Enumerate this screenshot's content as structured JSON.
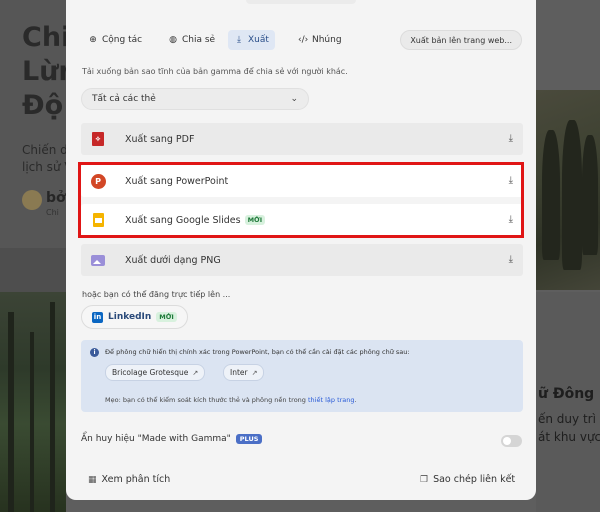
{
  "background": {
    "title_lines": [
      "Chi",
      "Lừn",
      "Độ"
    ],
    "paragraph_lines": [
      "Chiến dị",
      "lịch sử V"
    ],
    "author": "bởi",
    "author_sub": "Chi",
    "right_heading": "ữ Đông D",
    "right_lines": [
      "ến duy trì q",
      "át khu vực Đ"
    ]
  },
  "modal": {
    "tabs": [
      {
        "label": "Cộng tác",
        "icon": "add-person-icon"
      },
      {
        "label": "Chia sẻ",
        "icon": "globe-icon"
      },
      {
        "label": "Xuất",
        "icon": "download-icon"
      },
      {
        "label": "Nhúng",
        "icon": "code-icon"
      }
    ],
    "active_tab": "Xuất",
    "publish_label": "Xuất bản lên trang web...",
    "description": "Tải xuống bản sao tĩnh của bản gamma để chia sẻ với người khác.",
    "select_value": "Tất cả các thẻ",
    "exports": [
      {
        "label": "Xuất sang PDF",
        "icon": "pdf-icon",
        "badge": ""
      },
      {
        "label": "Xuất sang PowerPoint",
        "icon": "powerpoint-icon",
        "badge": ""
      },
      {
        "label": "Xuất sang Google Slides",
        "icon": "google-slides-icon",
        "badge": "MỚI"
      },
      {
        "label": "Xuất dưới dạng PNG",
        "icon": "image-icon",
        "badge": ""
      }
    ],
    "share_hint": "hoặc bạn có thể đăng trực tiếp lên ...",
    "linkedin_label": "LinkedIn",
    "linkedin_badge": "MỚI",
    "info": {
      "text": "Để phông chữ hiển thị chính xác trong PowerPoint, bạn có thể cần cài đặt các phông chữ sau:",
      "fonts": [
        "Bricolage Grotesque",
        "Inter"
      ],
      "tip_prefix": "Mẹo: bạn có thể kiểm soát kích thước thẻ và phông nền trong",
      "tip_link": "thiết lập trang",
      "tip_suffix": "."
    },
    "badge_toggle_label": "Ẩn huy hiệu \"Made with Gamma\"",
    "plus_badge": "PLUS",
    "badge_toggle_on": false,
    "footer": {
      "analytics_label": "Xem phân tích",
      "copy_link_label": "Sao chép liên kết"
    }
  },
  "colors": {
    "highlight": "#e01515",
    "active_tab_bg": "#dfe7f4",
    "info_bg": "#dbe4f2",
    "new_badge": "#1f7a3a",
    "plus_badge": "#4b6fc6"
  }
}
